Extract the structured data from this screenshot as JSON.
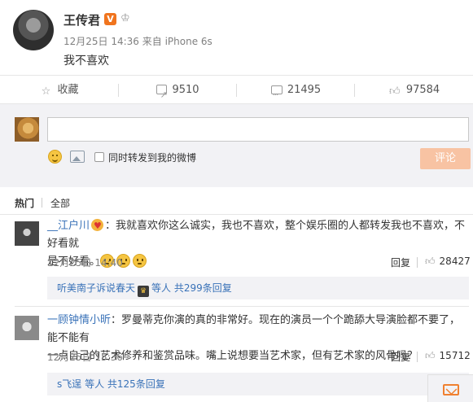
{
  "post": {
    "author": "王传君",
    "verified_badge": "V",
    "meta": "12月25日 14:36 来自 iPhone 6s",
    "text": "我不喜欢"
  },
  "actions": {
    "favorite": "收藏",
    "repost_count": "9510",
    "comment_count": "21495",
    "like_count": "97584"
  },
  "composer": {
    "input_value": "",
    "repost_checkbox_label": "同时转发到我的微博",
    "submit_label": "评论"
  },
  "tabs": {
    "hot": "热门",
    "all": "全部"
  },
  "comments": [
    {
      "user": "__江户川",
      "text_line1": "：我就喜欢你这么诚实，我也不喜欢，整个娱乐圈的人都转发我也不喜欢，不好看就",
      "text_line2": "是不好看。",
      "time": "12月25日 14:40",
      "reply": "回复",
      "likes": "28427",
      "sub_user": "听美南子诉说春天",
      "sub_summary": "等人 共299条回复"
    },
    {
      "user": "一顾钟情小昕",
      "text_line1": "：罗曼蒂克你演的真的非常好。现在的演员一个个跪舔大导演脸都不要了，能不能有",
      "text_line2": "一点自己的艺术修养和鉴赏品味。嘴上说想要当艺术家，但有艺术家的风骨吗？",
      "time": "12月25日 15:36",
      "reply": "回复",
      "likes": "15712",
      "sub_user": "s飞逞",
      "sub_summary": "等人 共125条回复"
    }
  ],
  "icons": {
    "favorite": "star-icon",
    "repost": "share-icon",
    "comment": "comment-icon",
    "like": "thumb-up-icon",
    "float": "mail-icon"
  },
  "colors": {
    "link_blue": "#3972b8",
    "submit_disabled": "#f8c3a3",
    "accent_orange": "#f08030"
  }
}
